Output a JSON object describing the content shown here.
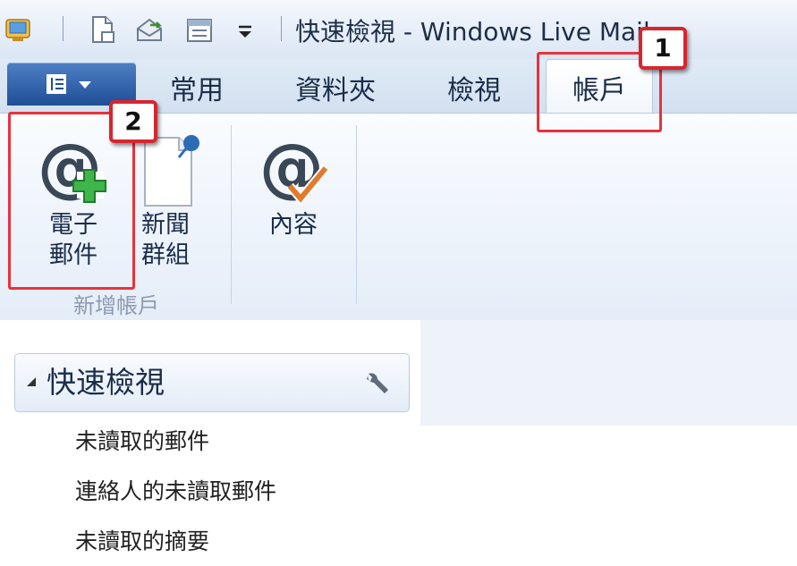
{
  "window": {
    "title": "快速檢視 - Windows Live Mail"
  },
  "tabs": [
    {
      "label": "常用"
    },
    {
      "label": "資料夾"
    },
    {
      "label": "檢視"
    },
    {
      "label": "帳戶"
    }
  ],
  "ribbon": {
    "buttons": [
      {
        "line1": "電子",
        "line2": "郵件"
      },
      {
        "line1": "新聞",
        "line2": "群組"
      },
      {
        "line1": "內容"
      }
    ],
    "group_label": "新增帳戶"
  },
  "annotations": [
    {
      "number": "1"
    },
    {
      "number": "2"
    }
  ],
  "quick_views": {
    "title": "快速檢視",
    "items": [
      {
        "label": "未讀取的郵件"
      },
      {
        "label": "連絡人的未讀取郵件"
      },
      {
        "label": "未讀取的摘要"
      }
    ]
  }
}
